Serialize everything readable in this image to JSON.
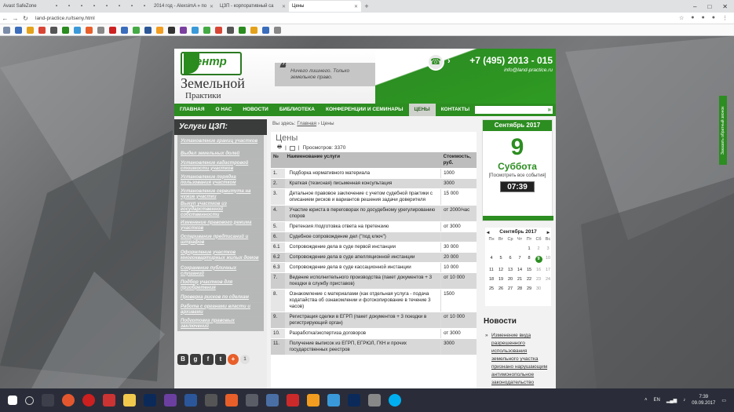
{
  "browser": {
    "brand_label": "Avast SafeZone",
    "tabs": [
      {
        "label": "2014 год - AlexsimA » по"
      },
      {
        "label": "ЦЗП - корпоративный са"
      },
      {
        "label": "Цены"
      }
    ],
    "url": "land-practice.ru/tseny.html"
  },
  "site": {
    "logo": {
      "line1": "Центр",
      "line2": "Земельной",
      "line3": "Практики"
    },
    "slogan": "Ничего лишнего. Только земельное право.",
    "phone": "+7 (495) 2013 - 015",
    "email": "info@land-practice.ru",
    "nav": [
      "ГЛАВНАЯ",
      "О НАС",
      "НОВОСТИ",
      "БИБЛИОТЕКА",
      "КОНФЕРЕНЦИИ И СЕМИНАРЫ",
      "ЦЕНЫ",
      "КОНТАКТЫ"
    ],
    "nav_active": "ЦЕНЫ"
  },
  "sidebar": {
    "title": "Услуги ЦЗП:",
    "items": [
      "Установление границ участков",
      "Выдел земельных долей",
      "Установление кадастровой стоимости участков",
      "Установление порядка пользования участком",
      "Установление сервитута на чужие участки",
      "Выкуп участков из государственной собственности",
      "Изменение правового режима участков",
      "Оспаривание предписаний и штрафов",
      "Оформление участков многоквартирных жилых домов",
      "Сохранение публичных слушаний",
      "Подбор участков для приобретения",
      "Проверка рисков по сделкам",
      "Работа с органами власти и архивами",
      "Подготовка правовых заключений"
    ],
    "share_buttons": [
      "В",
      "g",
      "f",
      "t",
      "+"
    ],
    "share_count": "1"
  },
  "breadcrumb": {
    "prefix": "Вы здесь:",
    "home": "Главная",
    "sep": "›",
    "current": "Цены"
  },
  "content": {
    "title": "Цены",
    "views_label": "Просмотров: 3370",
    "table_headers": [
      "№",
      "Наименование услуги",
      "Стоимость, руб."
    ],
    "rows": [
      [
        "1.",
        "Подборка нормативного материала",
        "1000"
      ],
      [
        "2.",
        "Краткая (тезисная) письменная консультация",
        "3000"
      ],
      [
        "3.",
        "Детальное правовое заключение с учетом судебной практики с описанием рисков и вариантов решения задачи доверителя",
        "15 000"
      ],
      [
        "4.",
        "Участие юриста в переговорах по досудебному урегулированию споров",
        "от 2000/час"
      ],
      [
        "5.",
        "Претензия /подготовка ответа на претензию",
        "от 3000"
      ],
      [
        "6.",
        "Судебное сопровождение дел (\"под ключ\")",
        ""
      ],
      [
        "6.1",
        "Сопровождение дела в суде первой инстанции",
        "30 000"
      ],
      [
        "6.2",
        "Сопровождение дела в суде апелляционной инстанции",
        "20 000"
      ],
      [
        "6.3",
        "Сопровождение дела в суде кассационной инстанции",
        "10 000"
      ],
      [
        "7.",
        "Ведение исполнительного производства (пакет документов + 3 поездки в службу приставов)",
        "от 10 000"
      ],
      [
        "8.",
        "Ознакомление с материалами (как отдельная услуга - подача ходатайства об ознакомлении и фотокопирование в течение 3 часов)",
        "1500"
      ],
      [
        "9.",
        "Регистрация сделки в ЕГРП (пакет документов + 3 поездки в регистрирующий орган)",
        "от 10 000"
      ],
      [
        "10.",
        "Разработка/экспертиза договоров",
        "от 3000"
      ],
      [
        "11.",
        "Получение выписок из ЕГРП, ЕГРЮЛ, ГКН и прочих государственных реестров",
        "3000"
      ]
    ]
  },
  "big_calendar": {
    "month": "Сентябрь 2017",
    "day": "9",
    "weekday": "Суббота",
    "all_events": "[Посмотреть все события]",
    "time": "07:39"
  },
  "small_calendar": {
    "month": "Сентябрь 2017",
    "weekdays": [
      "Пн",
      "Вт",
      "Ср",
      "Чт",
      "Пт",
      "Сб",
      "Вс"
    ],
    "days": [
      "",
      "",
      "",
      "",
      "1",
      "2",
      "3",
      "4",
      "5",
      "6",
      "7",
      "8",
      "9",
      "10",
      "11",
      "12",
      "13",
      "14",
      "15",
      "16",
      "17",
      "18",
      "19",
      "20",
      "21",
      "22",
      "23",
      "24",
      "25",
      "26",
      "27",
      "28",
      "29",
      "30",
      ""
    ],
    "today": "9"
  },
  "news": {
    "title": "Новости",
    "items": [
      "Изменение вида разрешенного использования земельного участка признано нарушающим антимонопольное законодательство"
    ]
  },
  "side_tab": "Заказать обратный звонок",
  "taskbar": {
    "lang": "EN",
    "time": "7:39",
    "date": "09.09.2017"
  },
  "colors": {
    "brand_green": "#2c8d21",
    "sidebar_dark": "#3a3b3b"
  }
}
